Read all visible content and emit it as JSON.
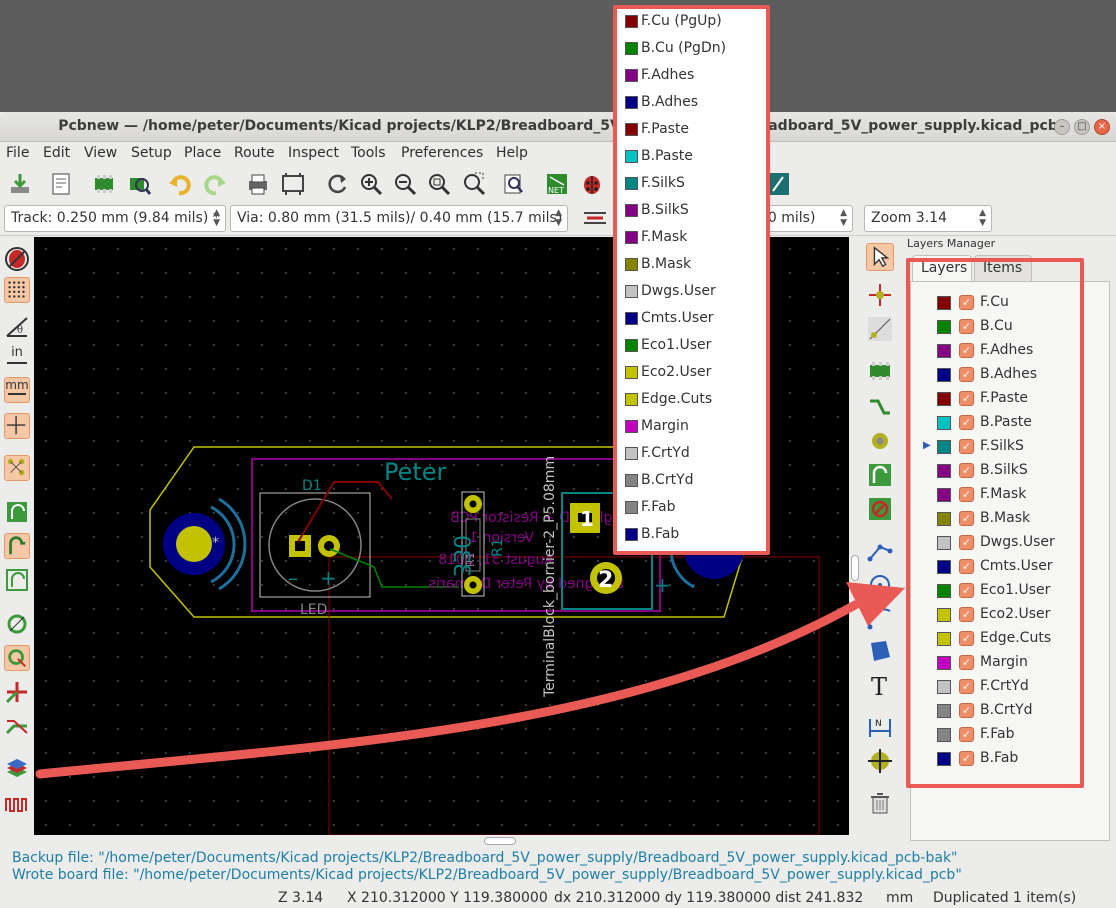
{
  "window": {
    "title": "Pcbnew — /home/peter/Documents/Kicad projects/KLP2/Breadboard_5V_power_supply/Breadboard_5V_power_supply.kicad_pcb",
    "min_label": "–",
    "max_label": "□",
    "close_label": "×"
  },
  "menu": [
    "File",
    "Edit",
    "View",
    "Setup",
    "Place",
    "Route",
    "Inspect",
    "Tools",
    "Preferences",
    "Help"
  ],
  "options": {
    "track": "Track: 0.250 mm (9.84 mils) *",
    "via": "Via: 0.80 mm (31.5 mils)/ 0.40 mm (15.7 mils) *",
    "grid": "00 mils)",
    "zoom": "Zoom 3.14",
    "arrow": "▲\n▼"
  },
  "left_toolbar": {
    "in_label": "in",
    "mm_label": "mm"
  },
  "pcb": {
    "silk_name": "Peter",
    "ref_d1": "D1",
    "ref_led": "LED",
    "ref_r1": "R1",
    "value_330": "330",
    "tb_label": "TerminalBlock_bornier-2_P5.08mm",
    "text_lines": [
      "Single LED + Resistor PCB",
      "Version 1",
      "August 31, 2018",
      "Designed by Peter Dalmaris"
    ],
    "pin1": "1",
    "pin2": "2",
    "minus": "–",
    "plus": "+",
    "star": "*"
  },
  "layers_manager": {
    "title": "Layers Manager",
    "tabs": [
      "Layers",
      "Items"
    ],
    "active_pointer": "▶",
    "check": "✓",
    "layers": [
      {
        "name": "F.Cu",
        "color": "#840000"
      },
      {
        "name": "B.Cu",
        "color": "#008400"
      },
      {
        "name": "F.Adhes",
        "color": "#840084"
      },
      {
        "name": "B.Adhes",
        "color": "#000084"
      },
      {
        "name": "F.Paste",
        "color": "#840000"
      },
      {
        "name": "B.Paste",
        "color": "#00c2c2"
      },
      {
        "name": "F.SilkS",
        "color": "#008484"
      },
      {
        "name": "B.SilkS",
        "color": "#840084"
      },
      {
        "name": "F.Mask",
        "color": "#840084"
      },
      {
        "name": "B.Mask",
        "color": "#848400"
      },
      {
        "name": "Dwgs.User",
        "color": "#c2c2c2"
      },
      {
        "name": "Cmts.User",
        "color": "#000084"
      },
      {
        "name": "Eco1.User",
        "color": "#008400"
      },
      {
        "name": "Eco2.User",
        "color": "#c2c200"
      },
      {
        "name": "Edge.Cuts",
        "color": "#c2c200"
      },
      {
        "name": "Margin",
        "color": "#c200c2"
      },
      {
        "name": "F.CrtYd",
        "color": "#c2c2c2"
      },
      {
        "name": "B.CrtYd",
        "color": "#848484"
      },
      {
        "name": "F.Fab",
        "color": "#848484"
      },
      {
        "name": "B.Fab",
        "color": "#000084"
      }
    ]
  },
  "popup": {
    "items": [
      {
        "name": "F.Cu (PgUp)",
        "color": "#840000"
      },
      {
        "name": "B.Cu (PgDn)",
        "color": "#008400"
      },
      {
        "name": "F.Adhes",
        "color": "#840084"
      },
      {
        "name": "B.Adhes",
        "color": "#000084"
      },
      {
        "name": "F.Paste",
        "color": "#840000"
      },
      {
        "name": "B.Paste",
        "color": "#00c2c2"
      },
      {
        "name": "F.SilkS",
        "color": "#008484"
      },
      {
        "name": "B.SilkS",
        "color": "#840084"
      },
      {
        "name": "F.Mask",
        "color": "#840084"
      },
      {
        "name": "B.Mask",
        "color": "#848400"
      },
      {
        "name": "Dwgs.User",
        "color": "#c2c2c2"
      },
      {
        "name": "Cmts.User",
        "color": "#000084"
      },
      {
        "name": "Eco1.User",
        "color": "#008400"
      },
      {
        "name": "Eco2.User",
        "color": "#c2c200"
      },
      {
        "name": "Edge.Cuts",
        "color": "#c2c200"
      },
      {
        "name": "Margin",
        "color": "#c200c2"
      },
      {
        "name": "F.CrtYd",
        "color": "#c2c2c2"
      },
      {
        "name": "B.CrtYd",
        "color": "#848484"
      },
      {
        "name": "F.Fab",
        "color": "#848484"
      },
      {
        "name": "B.Fab",
        "color": "#000084"
      }
    ]
  },
  "status": {
    "msg1": "Backup file: \"/home/peter/Documents/Kicad projects/KLP2/Breadboard_5V_power_supply/Breadboard_5V_power_supply.kicad_pcb-bak\"",
    "msg2": "Wrote board file: \"/home/peter/Documents/Kicad projects/KLP2/Breadboard_5V_power_supply/Breadboard_5V_power_supply.kicad_pcb\"",
    "zoom": "Z 3.14",
    "xy": "X 210.312000  Y 119.380000",
    "dxdy": "dx 210.312000  dy 119.380000  dist 241.832",
    "units": "mm",
    "info": "Duplicated 1 item(s)"
  },
  "colors": {
    "highlight": "#ea5a55",
    "silk": "#008484",
    "back_silk": "#840084",
    "edge": "#c2c200",
    "pad": "#c2c200"
  }
}
